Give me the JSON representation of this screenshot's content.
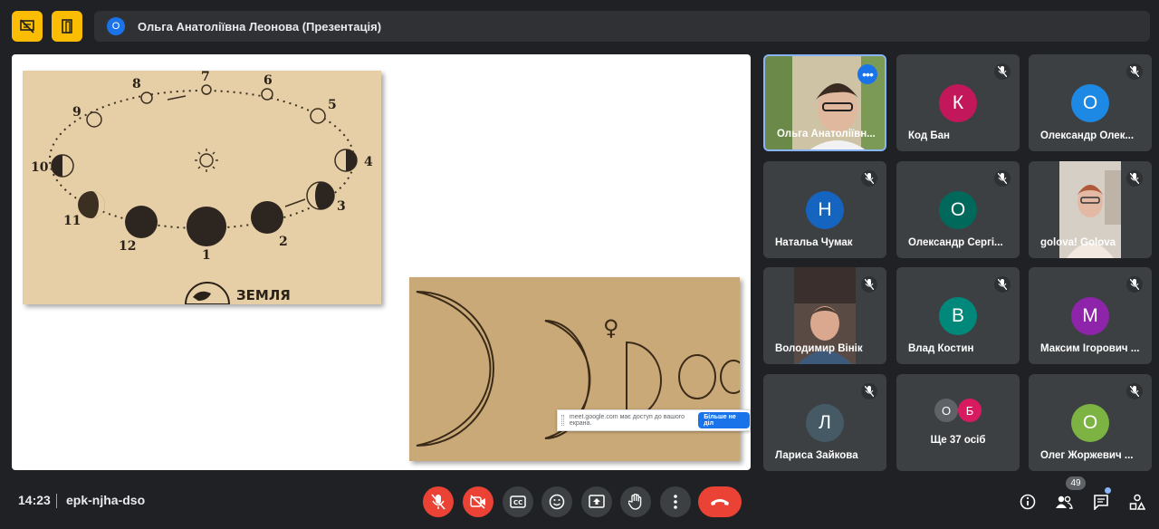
{
  "presenter_bar": {
    "avatar_letter": "О",
    "name": "Ольга Анатоліївна Леонова (Презентація)"
  },
  "slide": {
    "moon_diagram": {
      "phase_numbers": [
        "1",
        "2",
        "3",
        "4",
        "5",
        "6",
        "7",
        "8",
        "9",
        "10",
        "11",
        "12"
      ],
      "earth_label": "ЗЕМЛЯ"
    },
    "venus_symbol": "♀",
    "share_notice": {
      "text": "meet.google.com має доступ до вашого екрана.",
      "button": "Більше не діл"
    }
  },
  "participants": [
    {
      "name": "Ольга Анатоліївн...",
      "type": "video",
      "active": true
    },
    {
      "name": "Код Бан",
      "letter": "К",
      "color": "#c2185b"
    },
    {
      "name": "Олександр Олек...",
      "letter": "О",
      "color": "#1e88e5"
    },
    {
      "name": "Натальа Чумак",
      "letter": "Н",
      "color": "#1565c0"
    },
    {
      "name": "Олександр Сергі...",
      "letter": "О",
      "color": "#00695c"
    },
    {
      "name": "golova! Golova",
      "type": "video"
    },
    {
      "name": "Володимир Вінік",
      "type": "video"
    },
    {
      "name": "Влад Костин",
      "letter": "В",
      "color": "#00897b"
    },
    {
      "name": "Максим Ігорович ...",
      "letter": "М",
      "color": "#8e24aa"
    },
    {
      "name": "Лариса Зайкова",
      "letter": "Л",
      "color": "#455a64"
    },
    {
      "name": "Ще 37 осіб",
      "type": "more",
      "mini": [
        {
          "letter": "О",
          "color": "#5f6368"
        },
        {
          "letter": "Б",
          "color": "#d81b60"
        }
      ]
    },
    {
      "name": "Олег Жоржевич ...",
      "letter": "О",
      "color": "#7cb342"
    }
  ],
  "bottom": {
    "time": "14:23",
    "meeting_code": "epk-njha-dso",
    "people_count": "49"
  },
  "colors": {
    "accent_yellow": "#fbbc04",
    "danger_red": "#ea4335",
    "tile_bg": "#3c4043",
    "background": "#202124",
    "active_border": "#8ab4f8"
  }
}
